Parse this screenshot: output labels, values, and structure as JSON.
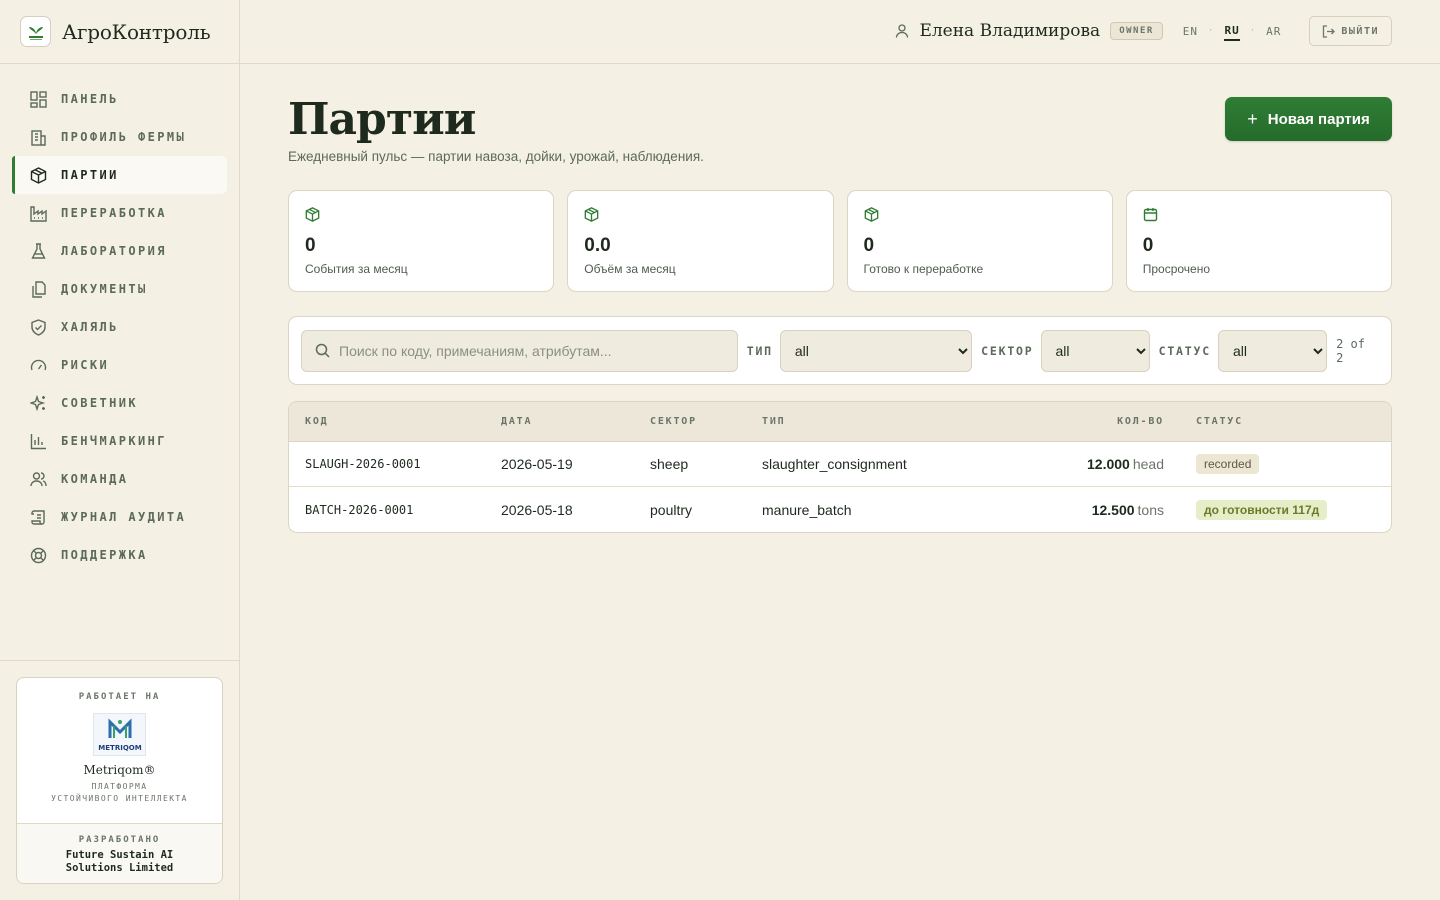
{
  "app": {
    "name": "АгроКонтроль"
  },
  "sidebar": {
    "items": [
      {
        "label": "ПАНЕЛЬ",
        "icon": "dashboard-icon"
      },
      {
        "label": "ПРОФИЛЬ ФЕРМЫ",
        "icon": "building-icon"
      },
      {
        "label": "ПАРТИИ",
        "icon": "package-icon",
        "active": true
      },
      {
        "label": "ПЕРЕРАБОТКА",
        "icon": "factory-icon"
      },
      {
        "label": "ЛАБОРАТОРИЯ",
        "icon": "flask-icon"
      },
      {
        "label": "ДОКУМЕНТЫ",
        "icon": "files-icon"
      },
      {
        "label": "ХАЛЯЛЬ",
        "icon": "shield-check-icon"
      },
      {
        "label": "РИСКИ",
        "icon": "gauge-icon"
      },
      {
        "label": "СОВЕТНИК",
        "icon": "sparkles-icon"
      },
      {
        "label": "БЕНЧМАРКИНГ",
        "icon": "bar-chart-icon"
      },
      {
        "label": "КОМАНДА",
        "icon": "users-icon"
      },
      {
        "label": "ЖУРНАЛ АУДИТА",
        "icon": "scroll-icon"
      },
      {
        "label": "ПОДДЕРЖКА",
        "icon": "lifebuoy-icon"
      }
    ],
    "powered": {
      "caption": "РАБОТАЕТ НА",
      "logo_text": "METRIQOM",
      "name": "Metriqom®",
      "sub_line1": "ПЛАТФОРМА",
      "sub_line2": "УСТОЙЧИВОГО ИНТЕЛЛЕКТА",
      "dev_caption": "РАЗРАБОТАНО",
      "company_line1": "Future Sustain AI",
      "company_line2": "Solutions Limited"
    }
  },
  "header": {
    "user_name": "Елена Владимирова",
    "role": "OWNER",
    "languages": [
      "EN",
      "RU",
      "AR"
    ],
    "active_language": "RU",
    "logout_label": "ВЫЙТИ"
  },
  "page": {
    "title": "Партии",
    "subtitle": "Ежедневный пульс — партии навоза, дойки, урожай, наблюдения.",
    "new_button": "Новая партия"
  },
  "stats": [
    {
      "value": "0",
      "label": "События за месяц",
      "icon": "package-icon"
    },
    {
      "value": "0.0",
      "label": "Объём за месяц",
      "icon": "package-icon"
    },
    {
      "value": "0",
      "label": "Готово к переработке",
      "icon": "package-icon"
    },
    {
      "value": "0",
      "label": "Просрочено",
      "icon": "calendar-icon"
    }
  ],
  "filters": {
    "search_placeholder": "Поиск по коду, примечаниям, атрибутам...",
    "type_label": "ТИП",
    "type_value": "all",
    "sector_label": "СЕКТОР",
    "sector_value": "all",
    "status_label": "СТАТУС",
    "status_value": "all",
    "count_text": "2 of 2"
  },
  "table": {
    "headers": {
      "code": "КОД",
      "date": "ДАТА",
      "sector": "СЕКТОР",
      "type": "ТИП",
      "qty": "КОЛ-ВО",
      "status": "СТАТУС"
    },
    "rows": [
      {
        "code": "SLAUGH-2026-0001",
        "date": "2026-05-19",
        "sector": "sheep",
        "type": "slaughter_consignment",
        "qty": "12.000",
        "unit": "head",
        "status": "recorded"
      },
      {
        "code": "BATCH-2026-0001",
        "date": "2026-05-18",
        "sector": "poultry",
        "type": "manure_batch",
        "qty": "12.500",
        "unit": "tons",
        "status": "до готовности 117д"
      }
    ]
  },
  "colors": {
    "accent": "#2e7d32",
    "background": "#f4f0e4"
  }
}
